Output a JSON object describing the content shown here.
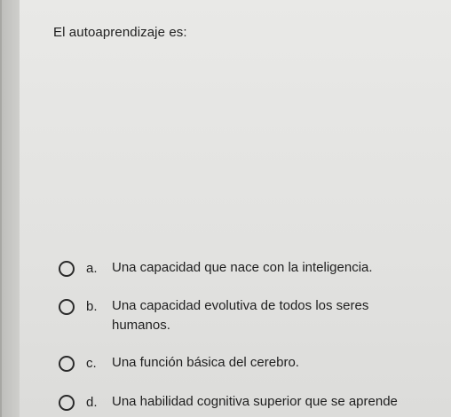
{
  "question": {
    "text": "El autoaprendizaje es:"
  },
  "options": [
    {
      "letter": "a.",
      "text": "Una capacidad que nace con la inteligencia."
    },
    {
      "letter": "b.",
      "text": "Una capacidad evolutiva de todos los seres humanos."
    },
    {
      "letter": "c.",
      "text": "Una función básica del cerebro."
    },
    {
      "letter": "d.",
      "text": "Una habilidad cognitiva superior que se aprende"
    }
  ]
}
